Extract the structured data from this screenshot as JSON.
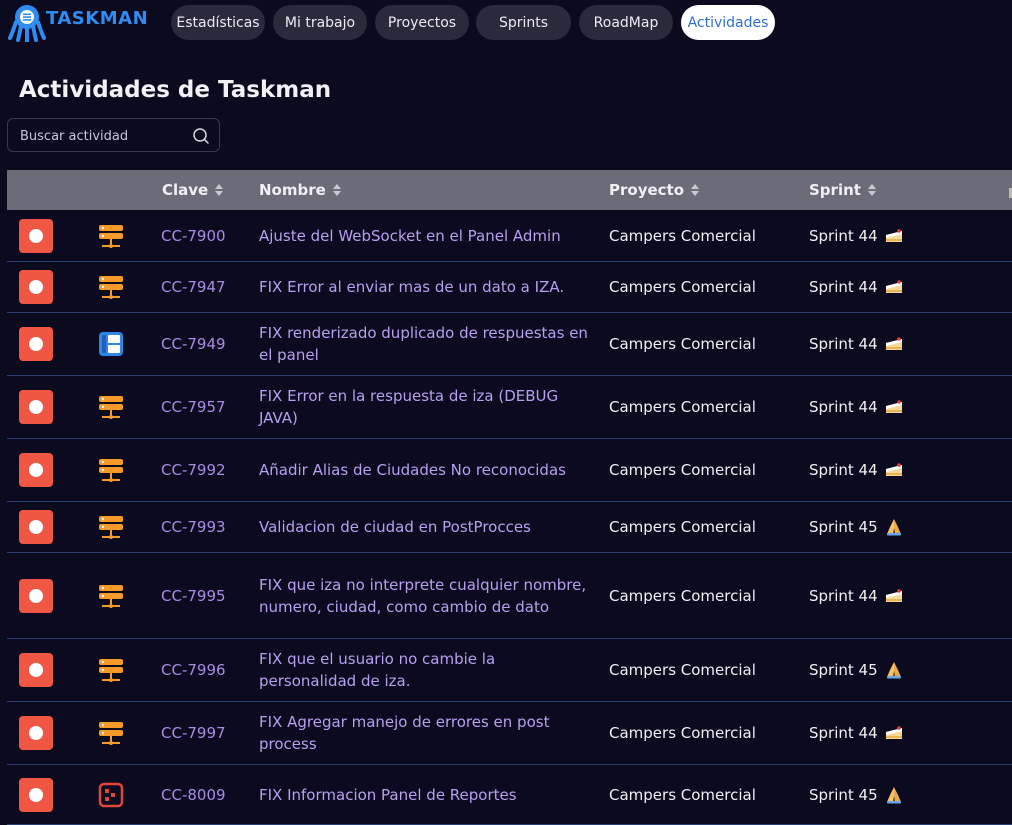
{
  "app": {
    "name": "TASKMAN"
  },
  "nav": {
    "tabs": [
      {
        "label": "Estadísticas",
        "active": false
      },
      {
        "label": "Mi trabajo",
        "active": false
      },
      {
        "label": "Proyectos",
        "active": false
      },
      {
        "label": "Sprints",
        "active": false
      },
      {
        "label": "RoadMap",
        "active": false
      },
      {
        "label": "Actividades",
        "active": true
      }
    ]
  },
  "page": {
    "title": "Actividades de Taskman"
  },
  "search": {
    "placeholder": "Buscar actividad",
    "value": ""
  },
  "table": {
    "columns": [
      "Clave",
      "Nombre",
      "Proyecto",
      "Sprint"
    ],
    "rows": [
      {
        "priority": "high",
        "type": "server",
        "key": "CC-7900",
        "name": "Ajuste del WebSocket en el Panel Admin",
        "project": "Campers Comercial",
        "sprint": "Sprint 44",
        "emoji": "cake"
      },
      {
        "priority": "high",
        "type": "server",
        "key": "CC-7947",
        "name": "FIX Error al enviar mas de un dato a IZA.",
        "project": "Campers Comercial",
        "sprint": "Sprint 44",
        "emoji": "cake"
      },
      {
        "priority": "high",
        "type": "layout",
        "key": "CC-7949",
        "name": "FIX renderizado duplicado de respuestas en el panel",
        "project": "Campers Comercial",
        "sprint": "Sprint 44",
        "emoji": "cake"
      },
      {
        "priority": "high",
        "type": "server",
        "key": "CC-7957",
        "name": "FIX Error en la respuesta de iza (DEBUG JAVA)",
        "project": "Campers Comercial",
        "sprint": "Sprint 44",
        "emoji": "cake"
      },
      {
        "priority": "high",
        "type": "server",
        "key": "CC-7992",
        "name": "Añadir Alias de Ciudades No reconocidas",
        "project": "Campers Comercial",
        "sprint": "Sprint 44",
        "emoji": "cake"
      },
      {
        "priority": "high",
        "type": "server",
        "key": "CC-7993",
        "name": "Validacion de ciudad en PostProcces",
        "project": "Campers Comercial",
        "sprint": "Sprint 45",
        "emoji": "pray"
      },
      {
        "priority": "high",
        "type": "server",
        "key": "CC-7995",
        "name": "FIX que iza no interprete cualquier nombre, numero, ciudad, como cambio de dato",
        "project": "Campers Comercial",
        "sprint": "Sprint 44",
        "emoji": "cake"
      },
      {
        "priority": "high",
        "type": "server",
        "key": "CC-7996",
        "name": "FIX que el usuario no cambie la personalidad de iza.",
        "project": "Campers Comercial",
        "sprint": "Sprint 45",
        "emoji": "pray"
      },
      {
        "priority": "high",
        "type": "server",
        "key": "CC-7997",
        "name": "FIX Agregar manejo de errores en post process",
        "project": "Campers Comercial",
        "sprint": "Sprint 44",
        "emoji": "cake"
      },
      {
        "priority": "high",
        "type": "report",
        "key": "CC-8009",
        "name": "FIX Informacion Panel de Reportes",
        "project": "Campers Comercial",
        "sprint": "Sprint 45",
        "emoji": "pray"
      }
    ]
  },
  "colors": {
    "background": "#0b0a1f",
    "accent": "#2f8cf0",
    "priority_high": "#ef5744",
    "link": "#b7a0f0",
    "row_border": "#2a3f6e"
  }
}
